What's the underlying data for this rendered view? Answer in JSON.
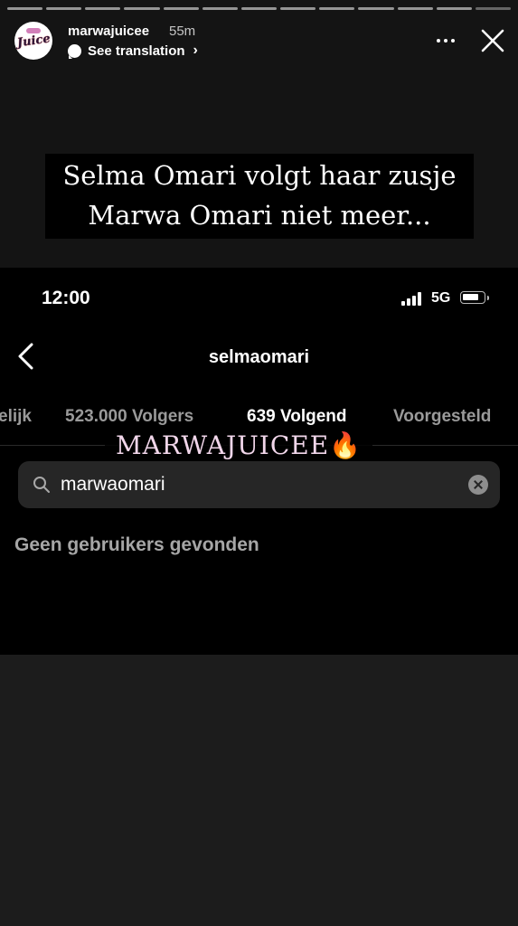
{
  "story": {
    "progress_segments": 13,
    "active_segment": 13,
    "account": {
      "username": "marwajuicee",
      "time_ago": "55m",
      "avatar_logo": "Juice",
      "avatar_icon": "juice-logo"
    },
    "translation": {
      "label": "See translation",
      "icon": "speech-bubble-icon"
    },
    "caption_lines": [
      "Selma Omari volgt haar zusje",
      "Marwa Omari niet meer..."
    ],
    "watermark": {
      "text": "MARWAJUICEE",
      "emoji": "🔥"
    }
  },
  "embedded_screen": {
    "status_bar": {
      "time": "12:00",
      "network": "5G"
    },
    "header": {
      "username": "selmaomari"
    },
    "tabs": [
      {
        "label": "elijk",
        "active": false
      },
      {
        "label": "523.000 Volgers",
        "active": false
      },
      {
        "label": "639 Volgend",
        "active": true
      },
      {
        "label": "Voorgesteld",
        "active": false
      }
    ],
    "search": {
      "value": "marwaomari",
      "placeholder": ""
    },
    "empty_state": "Geen gebruikers gevonden"
  },
  "colors": {
    "background": "#141414",
    "embedded_background": "#000000",
    "search_field": "#262626",
    "inactive_tab": "#9a9a9a",
    "watermark_text": "#f1d6ea"
  }
}
